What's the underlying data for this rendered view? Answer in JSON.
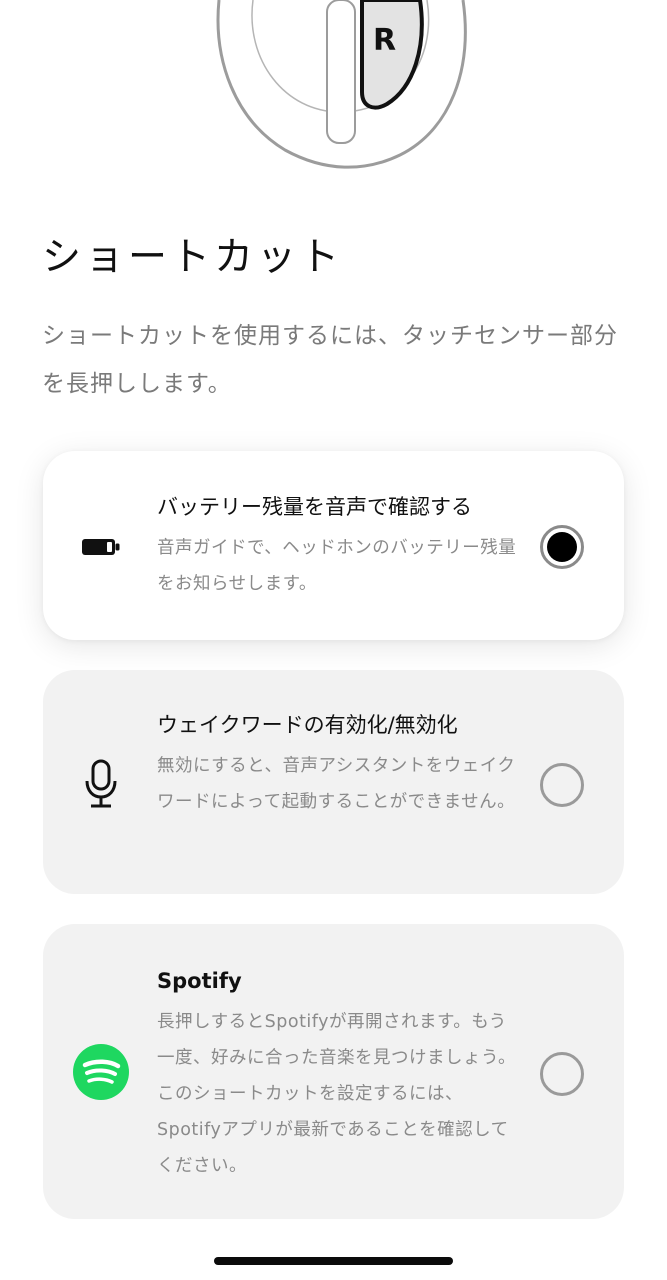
{
  "hero": {
    "earbud_side_label": "R"
  },
  "header": {
    "title": "ショートカット",
    "description": "ショートカットを使用するには、タッチセンサー部分を長押しします。"
  },
  "options": [
    {
      "title": "バッテリー残量を音声で確認する",
      "description": "音声ガイドで、ヘッドホンのバッテリー残量をお知らせします。",
      "icon": "battery-icon",
      "selected": true
    },
    {
      "title": "ウェイクワードの有効化/無効化",
      "description": "無効にすると、音声アシスタントをウェイクワードによって起動することができません。",
      "icon": "microphone-icon",
      "selected": false
    },
    {
      "title": "Spotify",
      "description": "長押しするとSpotifyが再開されます。もう一度、好みに合った音楽を見つけましょう。このショートカットを設定するには、Spotifyアプリが最新であることを確認してください。",
      "icon": "spotify-icon",
      "selected": false
    }
  ],
  "colors": {
    "spotify": "#1ed760",
    "card_bg": "#f2f2f2",
    "selected_card_bg": "#ffffff",
    "radio_fill": "#000000"
  }
}
